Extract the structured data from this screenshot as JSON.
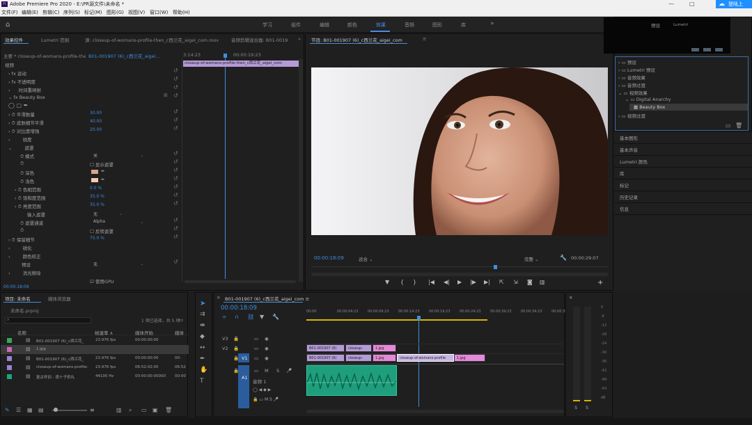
{
  "window": {
    "app": "Adobe Premiere Pro 2020 - E:\\PR源文件\\未命名 *",
    "login": "登陆上"
  },
  "menu": [
    "文件(F)",
    "编辑(E)",
    "剪辑(C)",
    "序列(S)",
    "标记(M)",
    "图形(G)",
    "视图(V)",
    "窗口(W)",
    "帮助(H)"
  ],
  "workspaces": [
    "学习",
    "组件",
    "编辑",
    "颜色",
    "效果",
    "音频",
    "图形",
    "库"
  ],
  "active_workspace": "效果",
  "effect_controls": {
    "tabs": [
      "效果控件",
      "Lumetri 范围",
      "源: closeup-of-womans-profile-then_c西兰花_aigei_com.mov",
      "音频剪辑混合器: B01-0019"
    ],
    "master": "主要 * closeup-of-womans-profile-then...",
    "seq": "B01-001907 (6)_c西兰花_aigei...",
    "time_a": "3:14:23",
    "time_b": "00:00:19:23",
    "clip_label": "closeup-of-womans-profile-then_c西兰花_aigei_com",
    "section": "视频",
    "fx": [
      "运动",
      "不透明度",
      "时间重映射"
    ],
    "beauty": "Beauty Box",
    "params": [
      {
        "label": "平滑数量",
        "value": "30.00"
      },
      {
        "label": "皮肤细节平滑",
        "value": "40.00"
      },
      {
        "label": "对比度增强",
        "value": "20.00"
      },
      {
        "label": "锐度",
        "value": ""
      },
      {
        "label": "遮罩",
        "value": ""
      },
      {
        "label": "模式",
        "value": "关"
      },
      {
        "label": "",
        "value": "显示遮罩"
      },
      {
        "label": "深色",
        "value": ""
      },
      {
        "label": "浅色",
        "value": ""
      },
      {
        "label": "色相范围",
        "value": "0.0 %"
      },
      {
        "label": "饱和度范围",
        "value": "35.0 %"
      },
      {
        "label": "亮度范围",
        "value": "35.0 %"
      },
      {
        "label": "输入遮罩",
        "value": "无"
      },
      {
        "label": "遮罩通道",
        "value": "Alpha"
      },
      {
        "label": "",
        "value": "反转遮罩"
      },
      {
        "label": "保留细节",
        "value": "75.0 %"
      },
      {
        "label": "锐化",
        "value": ""
      },
      {
        "label": "颜色校正",
        "value": ""
      },
      {
        "label": "预设",
        "value": "无"
      },
      {
        "label": "消光移除",
        "value": ""
      },
      {
        "label": "",
        "value": "使用GPU"
      }
    ],
    "timecode": "00:00:18:09"
  },
  "program": {
    "tab": "节目: B01-001907 (6)_c西兰花_aigei_com",
    "timecode": "00:00:18:09",
    "fit": "适合",
    "quality": "完整",
    "duration": "00:00:29:07"
  },
  "effects_panel": {
    "thumb_labels": [
      "预设",
      "Lumetri"
    ],
    "tree": [
      "预设",
      "Lumetri 预设",
      "音频效果",
      "音频过渡",
      "视频效果",
      "Digital Anarchy",
      "Beauty Box",
      "视频过渡"
    ]
  },
  "side_panels": [
    "基本图形",
    "基本声音",
    "Lumetri 颜色",
    "库",
    "标记",
    "历史记录",
    "信息"
  ],
  "project": {
    "tabs": [
      "项目: 未命名",
      "媒体浏览器"
    ],
    "file": "未命名.prproj",
    "status": "1 项已选择，共 5 项",
    "columns": [
      "名称",
      "帧速率",
      "媒体开始",
      "媒体"
    ],
    "rows": [
      {
        "name": "B01-001907 (6)_c西兰花_",
        "fps": "23.976 fps",
        "start": "00:00:00:00",
        "end": "",
        "color": "#35a852"
      },
      {
        "name": "1.jpg",
        "fps": "",
        "start": "",
        "end": "",
        "color": "#c66ab2"
      },
      {
        "name": "B01-001907 (6)_c西兰花_",
        "fps": "23.976 fps",
        "start": "00:00:00:00",
        "end": "00:",
        "color": "#9b82d0"
      },
      {
        "name": "closeup-of-womans-profile-",
        "fps": "23.976 fps",
        "start": "06:52:02:00",
        "end": "06:52",
        "color": "#9b82d0"
      },
      {
        "name": "复古怀旧 - 夜十子供丸",
        "fps": "44100 Hz",
        "start": "00:00:00:00000",
        "end": "00:00",
        "color": "#19a67f"
      }
    ]
  },
  "timeline": {
    "tab": "B01-001907 (6)_c西兰花_aigei_com",
    "timecode": "00:00:18:09",
    "ruler": [
      "00:00",
      "00:00:04:23",
      "00:00:09:23",
      "00:00:14:23",
      "00:00:19:23",
      "00:00:24:23",
      "00:00:29:23",
      "00:00:34:23",
      "00:00:39:"
    ],
    "tracks": [
      "V3",
      "V2",
      "V1",
      "A1"
    ],
    "audio_label": "音频 1",
    "v2": [
      "B01-001907 (6)",
      "closeup-",
      "1.jpg"
    ],
    "v1": [
      "B01-001907 (6)",
      "closeup-",
      "1.jpg",
      "closeup-of-womans-profile",
      "1.jpg"
    ]
  },
  "meter": {
    "scale": [
      "0",
      "-6",
      "-12",
      "-18",
      "-24",
      "-30",
      "-36",
      "-42",
      "-48",
      "-54",
      "dB"
    ],
    "channels": [
      "S",
      "S"
    ]
  }
}
